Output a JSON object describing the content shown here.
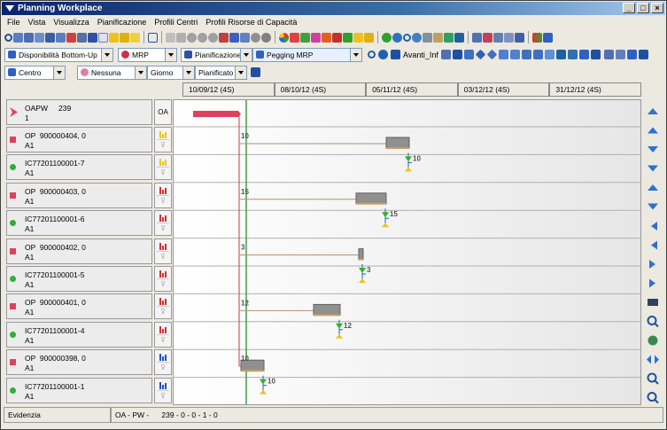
{
  "window": {
    "title": "Planning Workplace"
  },
  "menu": [
    "File",
    "Vista",
    "Visualizza",
    "Pianificazione",
    "Profili Centri",
    "Profili Risorse di Capacità"
  ],
  "toolbar2": {
    "combo1": "Disponibilità Bottom-Up",
    "combo2": "MRP",
    "combo3": "Pianificazione",
    "combo4": "Pegging MRP",
    "avanti": "Avanti_Inf"
  },
  "toolbar3": {
    "combo1": "Centro",
    "combo2": "Nessuna",
    "combo3": "Giorno",
    "combo4": "Pianificato"
  },
  "timeline": [
    "10/09/12 (4S)",
    "08/10/12 (4S)",
    "05/11/12 (4S)",
    "03/12/12 (4S)",
    "31/12/12 (4S)"
  ],
  "header_row": {
    "code": "OAPW",
    "qty": "239",
    "sub": "1",
    "col": "OA"
  },
  "rows": [
    {
      "type": "OP",
      "line1": "OP  900000404, 0",
      "line2": "A1",
      "color": "#e04060",
      "bars": "#e8c800",
      "qty": "10"
    },
    {
      "type": "IC",
      "line1": "IC77201100001-7",
      "line2": "A1",
      "color": "#30b030",
      "bars": "#e8c800",
      "qty": "10"
    },
    {
      "type": "OP",
      "line1": "OP  900000403, 0",
      "line2": "A1",
      "color": "#e04060",
      "bars": "#d03030",
      "qty": "15"
    },
    {
      "type": "IC",
      "line1": "IC77201100001-6",
      "line2": "A1",
      "color": "#30b030",
      "bars": "#d03030",
      "qty": "15"
    },
    {
      "type": "OP",
      "line1": "OP  900000402, 0",
      "line2": "A1",
      "color": "#e04060",
      "bars": "#d03030",
      "qty": "3"
    },
    {
      "type": "IC",
      "line1": "IC77201100001-5",
      "line2": "A1",
      "color": "#30b030",
      "bars": "#d03030",
      "qty": "3"
    },
    {
      "type": "OP",
      "line1": "OP  900000401, 0",
      "line2": "A1",
      "color": "#e04060",
      "bars": "#d03030",
      "qty": "12"
    },
    {
      "type": "IC",
      "line1": "IC77201100001-4",
      "line2": "A1",
      "color": "#30b030",
      "bars": "#d03030",
      "qty": "12"
    },
    {
      "type": "OP",
      "line1": "OP  900000398, 0",
      "line2": "A1",
      "color": "#e04060",
      "bars": "#2050c0",
      "qty": "10"
    },
    {
      "type": "IC",
      "line1": "IC77201100001-1",
      "line2": "A1",
      "color": "#30b030",
      "bars": "#2050c0",
      "qty": "10"
    }
  ],
  "status": {
    "left": "Evidenzia",
    "right": "OA - PW -      239 - 0 - 0 - 1 - 0"
  }
}
